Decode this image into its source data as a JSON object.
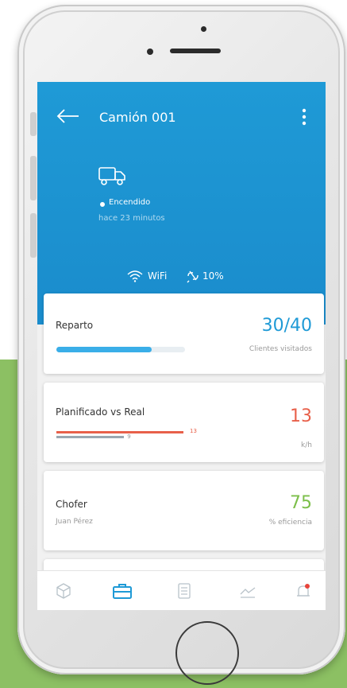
{
  "header": {
    "title": "Camión 001",
    "status": "Encendido",
    "status_time": "hace 23 minutos",
    "wifi_label": "WiFi",
    "battery_label": "10%"
  },
  "cards": {
    "reparto": {
      "label": "Reparto",
      "value": "30/40",
      "sub": "Clientes visitados",
      "progress": 0.74
    },
    "planificado": {
      "label": "Planificado vs Real",
      "value": "13",
      "sub": "k/h",
      "planned": 13,
      "planned_label": "13",
      "real": 9,
      "real_label": "9"
    },
    "chofer": {
      "label": "Chofer",
      "name": "Juan Pérez",
      "value": "75",
      "sub": "% eficiencia"
    }
  },
  "tabs": [
    "box-icon",
    "briefcase-icon",
    "document-icon",
    "chart-icon",
    "bell-icon"
  ],
  "colors": {
    "header_blue": "#1f9ad6",
    "value_blue": "#1f9ad6",
    "value_red": "#e8604a",
    "value_green": "#7cbf4a",
    "background_green": "#8cc063"
  }
}
